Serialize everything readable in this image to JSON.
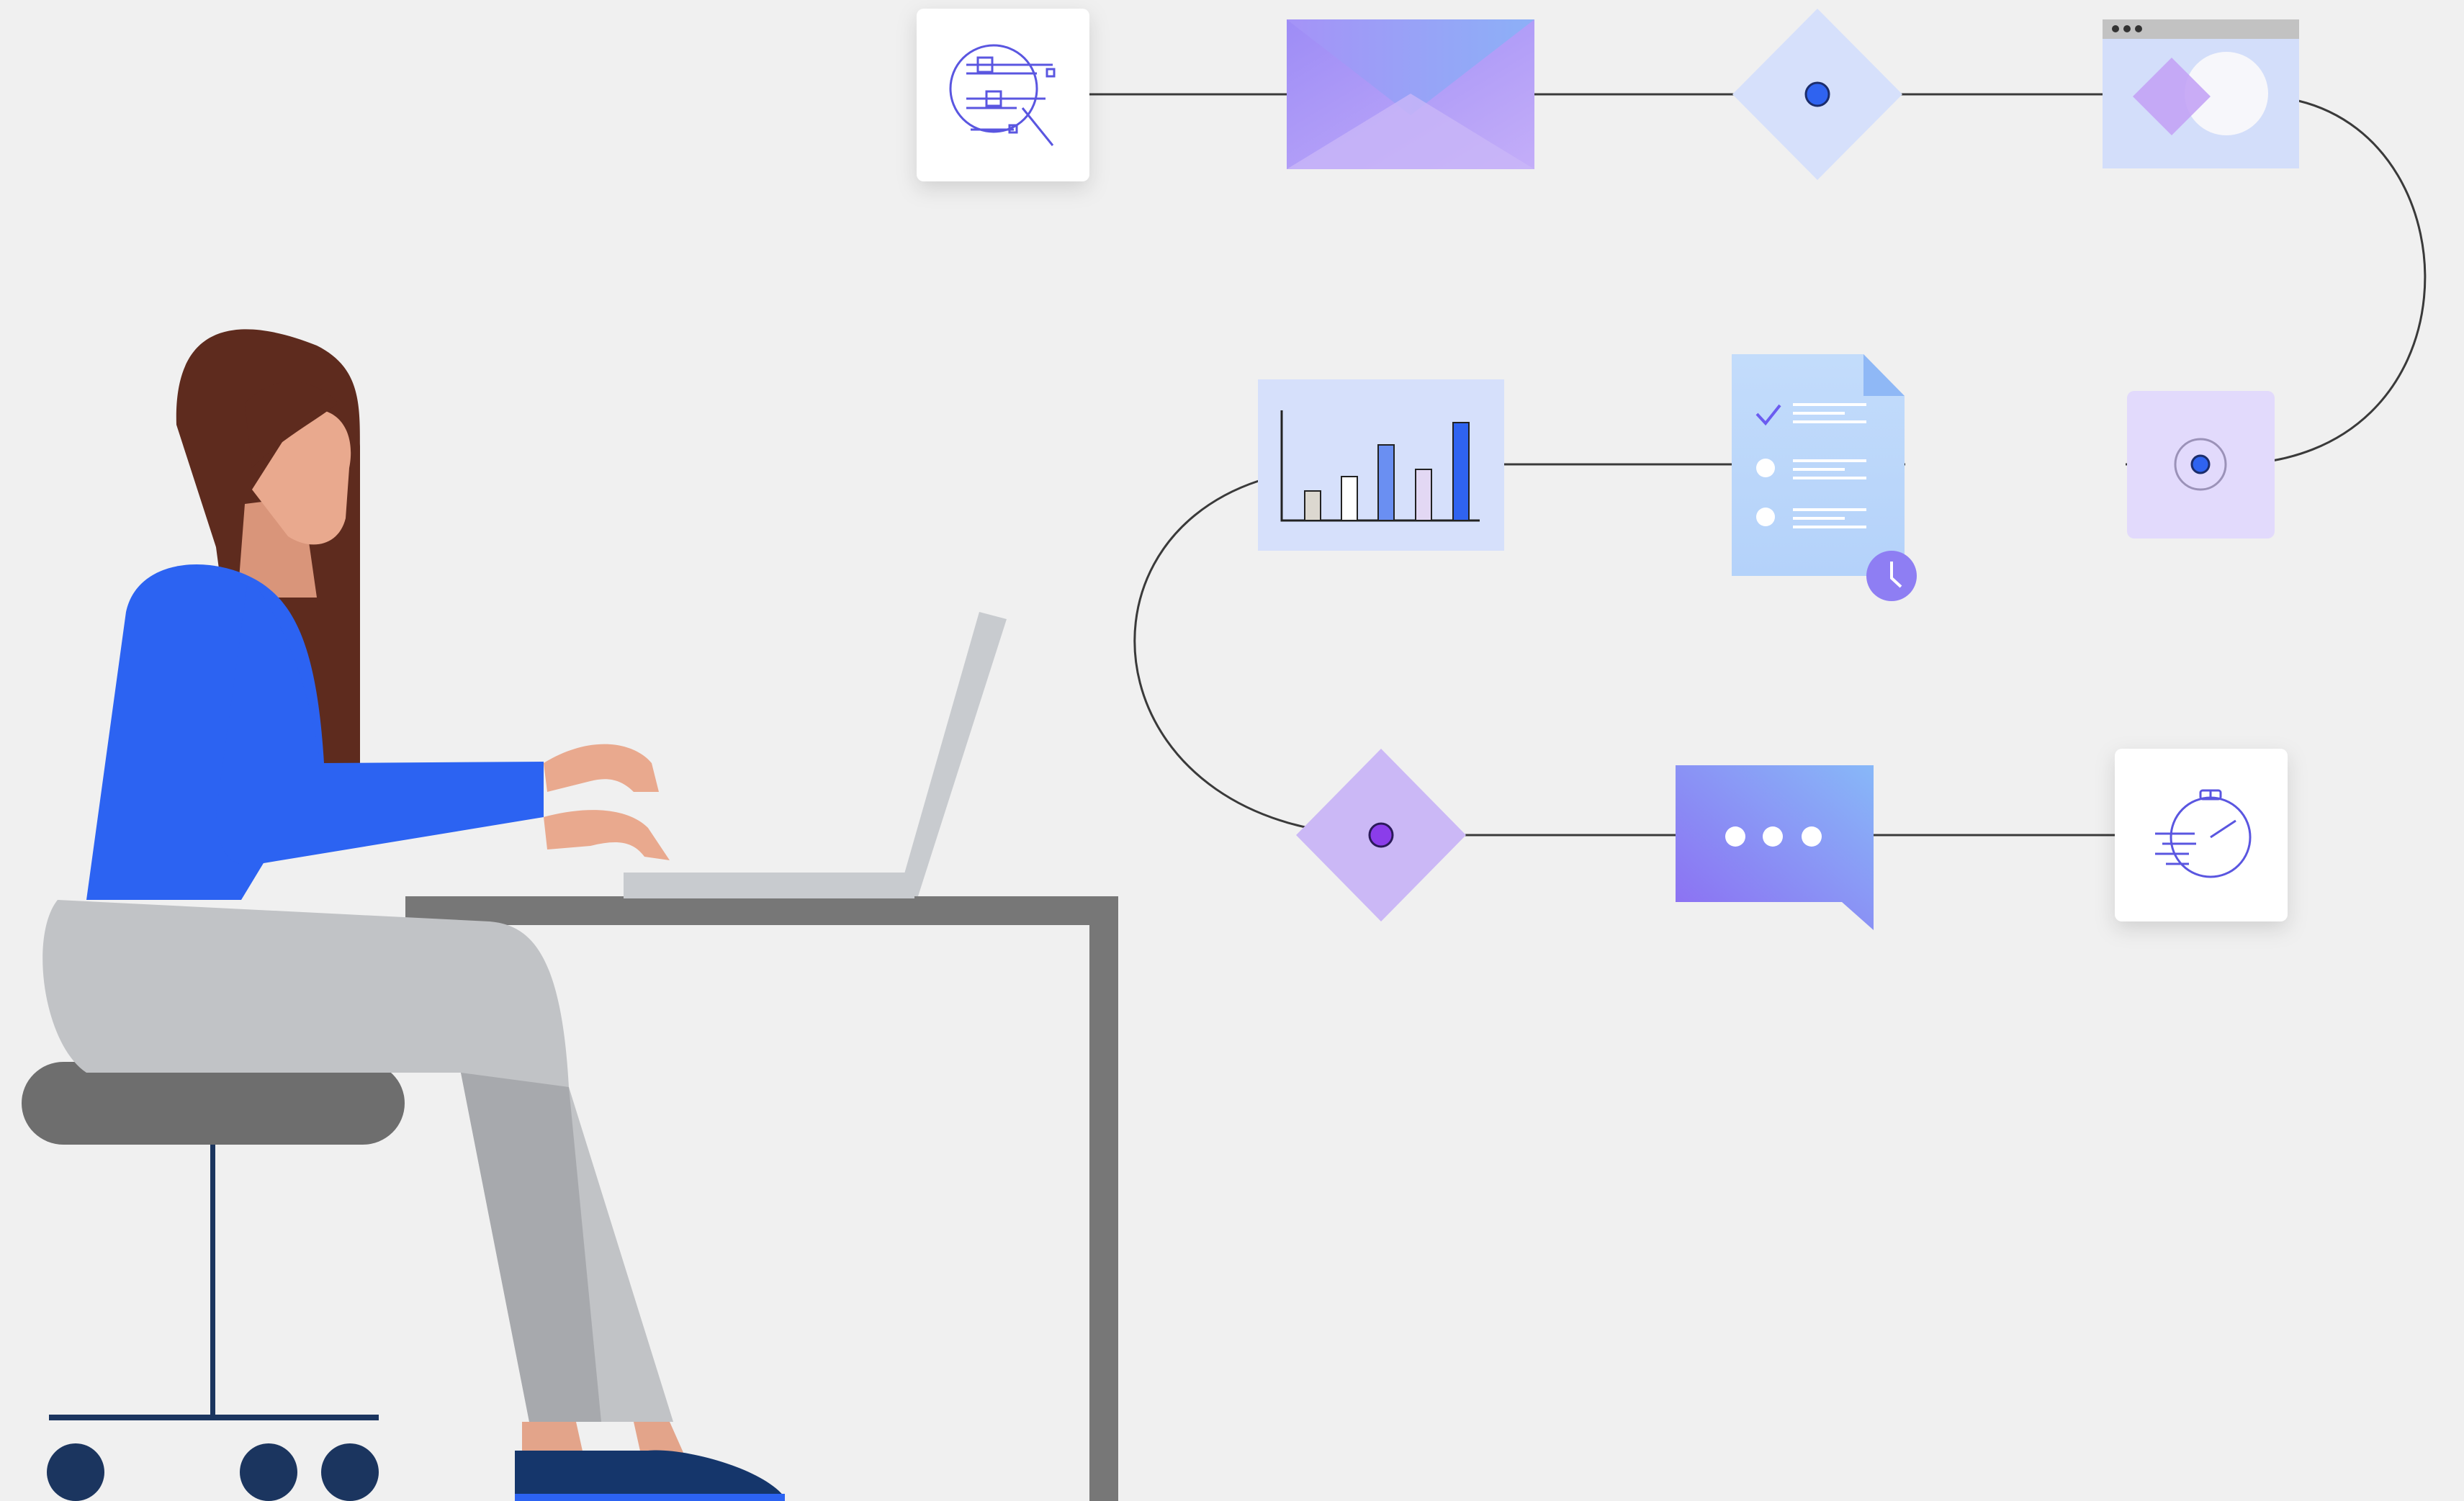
{
  "palette": {
    "background": "#f0f0f0",
    "line": "#333333",
    "blue_accent": "#2f63f0",
    "purple_accent": "#8b5cf6",
    "light_blue_tile": "#d6e0fb",
    "light_purple_tile": "#e2dafc",
    "lavender": "#c9b6f7",
    "hair": "#5e2b1e",
    "skin": "#e9a98e",
    "top": "#2c63f2",
    "pants": "#c1c3c6",
    "shoes": "#15366b",
    "desk": "#777777",
    "stool": "#6e6e6e",
    "stool_base": "#1b355f",
    "laptop": "#c8cbcf"
  },
  "workflow_steps": [
    {
      "icon": "data-filter-search-icon"
    },
    {
      "icon": "envelope-icon"
    },
    {
      "icon": "decision-diamond-icon"
    },
    {
      "icon": "browser-window-icon"
    },
    {
      "icon": "radio-target-icon"
    },
    {
      "icon": "checklist-document-icon"
    },
    {
      "icon": "bar-chart-icon"
    },
    {
      "icon": "decision-diamond-purple-icon"
    },
    {
      "icon": "chat-bubble-icon"
    },
    {
      "icon": "stopwatch-icon"
    }
  ],
  "scene": {
    "person": "woman-typing-on-laptop",
    "furniture": [
      "desk",
      "stool",
      "laptop"
    ]
  }
}
